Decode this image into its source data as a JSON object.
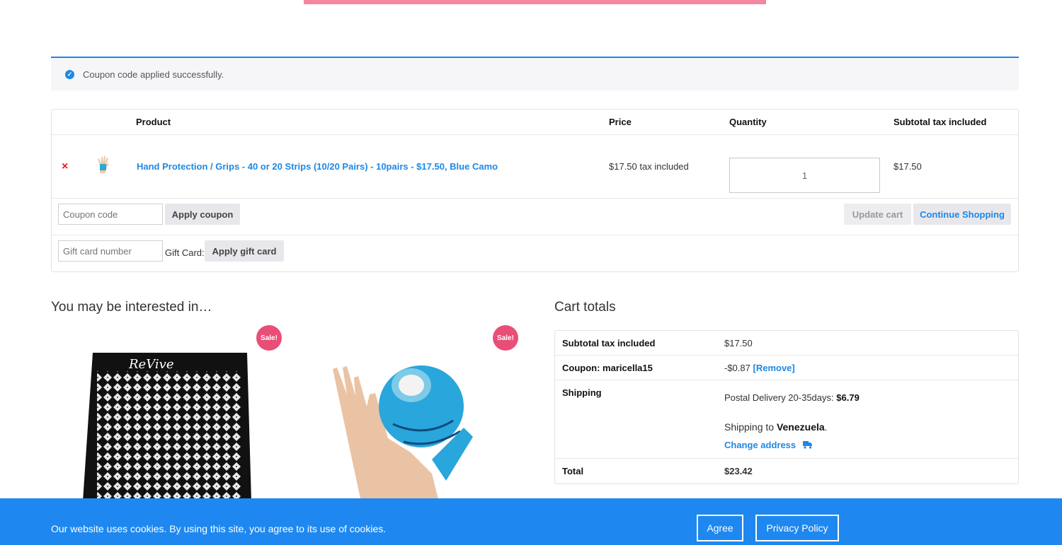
{
  "notice": {
    "message": "Coupon code applied successfully."
  },
  "cart_table": {
    "headers": {
      "product": "Product",
      "price": "Price",
      "quantity": "Quantity",
      "subtotal": "Subtotal tax included"
    },
    "items": [
      {
        "remove": "×",
        "name": "Hand Protection / Grips - 40 or 20 Strips (10/20 Pairs) - 10pairs - $17.50, Blue Camo",
        "price": "$17.50 tax included",
        "quantity": "1",
        "subtotal": "$17.50"
      }
    ],
    "coupon_placeholder": "Coupon code",
    "apply_coupon": "Apply coupon",
    "update_cart": "Update cart",
    "continue_shopping": "Continue Shopping",
    "gift_placeholder": "Gift card number",
    "gift_label": "Gift Card:",
    "apply_gift": "Apply gift card"
  },
  "cross_sells": {
    "heading": "You may be interested in…",
    "sale_badge": "Sale!",
    "mat_brand": "ReVive"
  },
  "totals": {
    "heading": "Cart totals",
    "subtotal_label": "Subtotal tax included",
    "subtotal_value": "$17.50",
    "coupon_label": "Coupon: maricella15",
    "coupon_value": "-$0.87",
    "coupon_remove": "[Remove]",
    "shipping_label": "Shipping",
    "shipping_method": "Postal Delivery 20-35days:",
    "shipping_cost": "$6.79",
    "shipping_to": "Shipping to",
    "shipping_country": "Venezuela",
    "change_address": "Change address",
    "total_label": "Total",
    "total_value": "$23.42"
  },
  "cookie": {
    "text": "Our website uses cookies. By using this site, you agree to its use of cookies.",
    "agree": "Agree",
    "privacy": "Privacy Policy"
  },
  "colors": {
    "accent": "#1e88e5",
    "sale": "#e94e77",
    "cookie_bg": "#1e88f0",
    "top_bar": "#f4879f"
  }
}
